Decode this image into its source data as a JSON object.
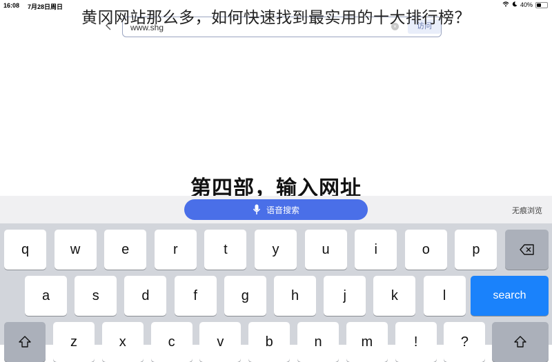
{
  "status_bar": {
    "time": "16:08",
    "date": "7月28日周日",
    "battery": "40%",
    "battery_level": 0.4
  },
  "overlay_title": "黄冈网站那么多，如何快速找到最实用的十大排行榜？",
  "browser": {
    "back_label": "‹",
    "url_value": "www.shg",
    "clear_icon": "×",
    "visit_label": "访问"
  },
  "caption": "第四部，输入网址",
  "toolbar": {
    "voice_search_label": "语音搜索",
    "incognito_label": "无痕浏览"
  },
  "keyboard": {
    "row1": [
      "q",
      "w",
      "e",
      "r",
      "t",
      "y",
      "u",
      "i",
      "o",
      "p"
    ],
    "row2": [
      "a",
      "s",
      "d",
      "f",
      "g",
      "h",
      "j",
      "k",
      "l"
    ],
    "row3": [
      "z",
      "x",
      "c",
      "v",
      "b",
      "n",
      "m",
      "!",
      "?"
    ],
    "backspace": "⌫",
    "search": "search",
    "shift": "⇧"
  },
  "colors": {
    "accent": "#4a6fe8",
    "search_key": "#1a82fb",
    "keyboard_bg": "#d2d5db"
  }
}
